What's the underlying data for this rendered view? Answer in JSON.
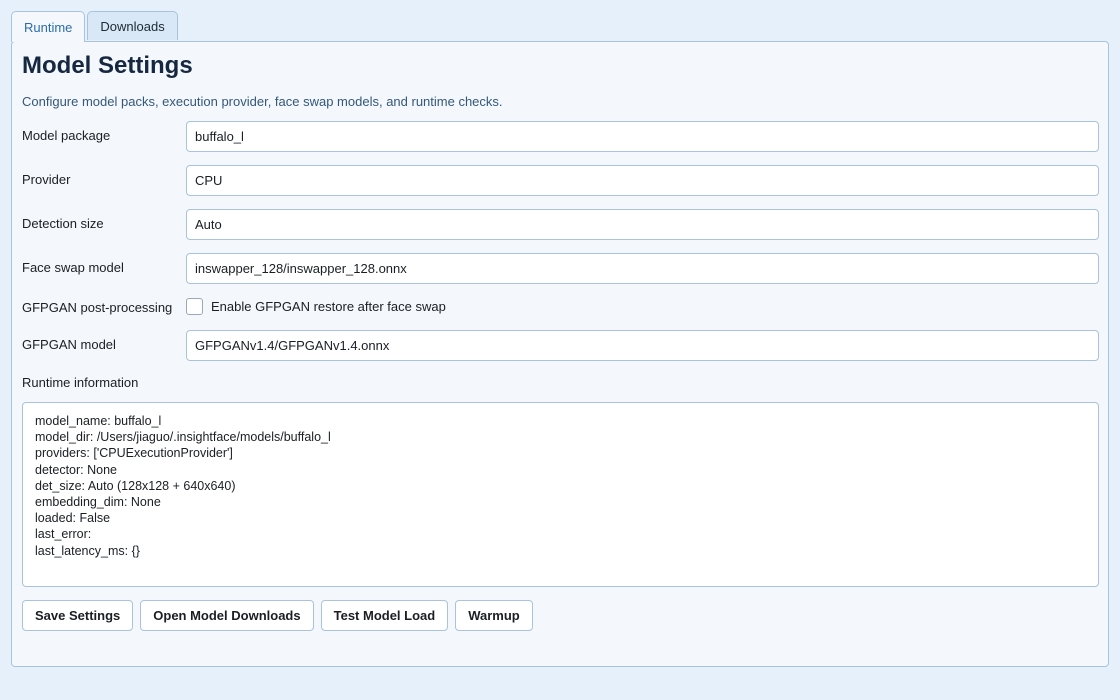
{
  "tabs": [
    {
      "label": "Runtime",
      "active": true
    },
    {
      "label": "Downloads",
      "active": false
    }
  ],
  "header": {
    "title": "Model Settings",
    "subtitle": "Configure model packs, execution provider, face swap models, and runtime checks."
  },
  "form": {
    "model_package": {
      "label": "Model package",
      "value": "buffalo_l"
    },
    "provider": {
      "label": "Provider",
      "value": "CPU"
    },
    "detection_size": {
      "label": "Detection size",
      "value": "Auto"
    },
    "face_swap_model": {
      "label": "Face swap model",
      "value": "inswapper_128/inswapper_128.onnx"
    },
    "gfpgan_post": {
      "label": "GFPGAN post-processing",
      "checkbox_label": "Enable GFPGAN restore after face swap",
      "checked": false
    },
    "gfpgan_model": {
      "label": "GFPGAN model",
      "value": "GFPGANv1.4/GFPGANv1.4.onnx"
    }
  },
  "runtime_info": {
    "label": "Runtime information",
    "lines": [
      "model_name: buffalo_l",
      "model_dir: /Users/jiaguo/.insightface/models/buffalo_l",
      "providers: ['CPUExecutionProvider']",
      "detector: None",
      "det_size: Auto (128x128 + 640x640)",
      "embedding_dim: None",
      "loaded: False",
      "last_error:",
      "last_latency_ms: {}"
    ]
  },
  "actions": {
    "save": "Save Settings",
    "open_downloads": "Open Model Downloads",
    "test_load": "Test Model Load",
    "warmup": "Warmup"
  }
}
